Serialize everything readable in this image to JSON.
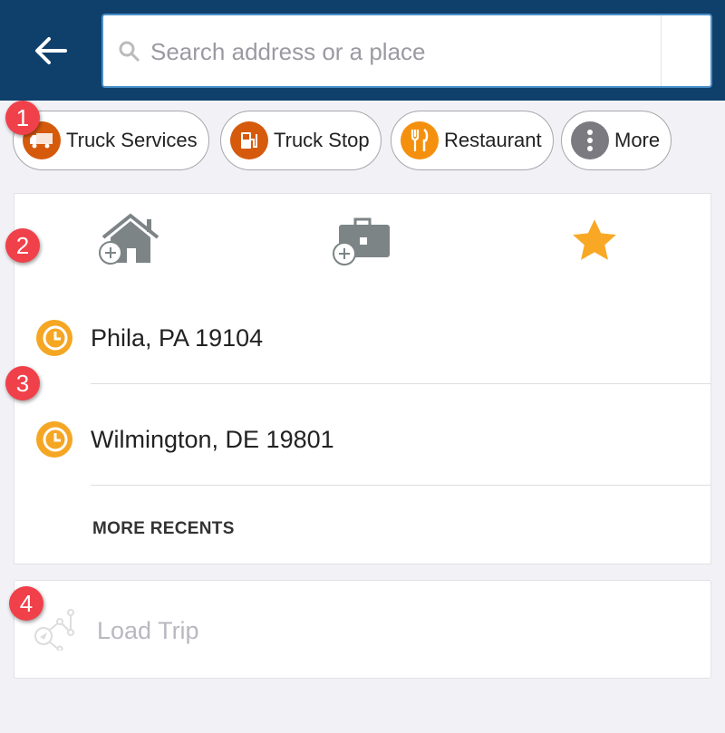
{
  "header": {
    "back_icon": "arrow-left-icon",
    "search_placeholder": "Search address or a place",
    "search_value": ""
  },
  "chips": [
    {
      "label": "Truck Services",
      "icon": "truck-icon",
      "color": "#d65a0c"
    },
    {
      "label": "Truck Stop",
      "icon": "fuel-pump-icon",
      "color": "#d65a0c"
    },
    {
      "label": "Restaurant",
      "icon": "fork-knife-icon",
      "color": "#f5900f"
    },
    {
      "label": "More",
      "icon": "more-vertical-icon",
      "color": "#7a7a80"
    }
  ],
  "shortcuts": [
    {
      "icon": "add-home-icon"
    },
    {
      "icon": "add-work-icon"
    },
    {
      "icon": "star-icon",
      "color": "#f9a825"
    }
  ],
  "recents": [
    {
      "label": "Phila, PA 19104",
      "icon": "history-icon"
    },
    {
      "label": "Wilmington, DE 19801",
      "icon": "history-icon"
    }
  ],
  "more_recents": "MORE RECENTS",
  "load_trip": "Load Trip",
  "badges": [
    "1",
    "2",
    "3",
    "4"
  ]
}
